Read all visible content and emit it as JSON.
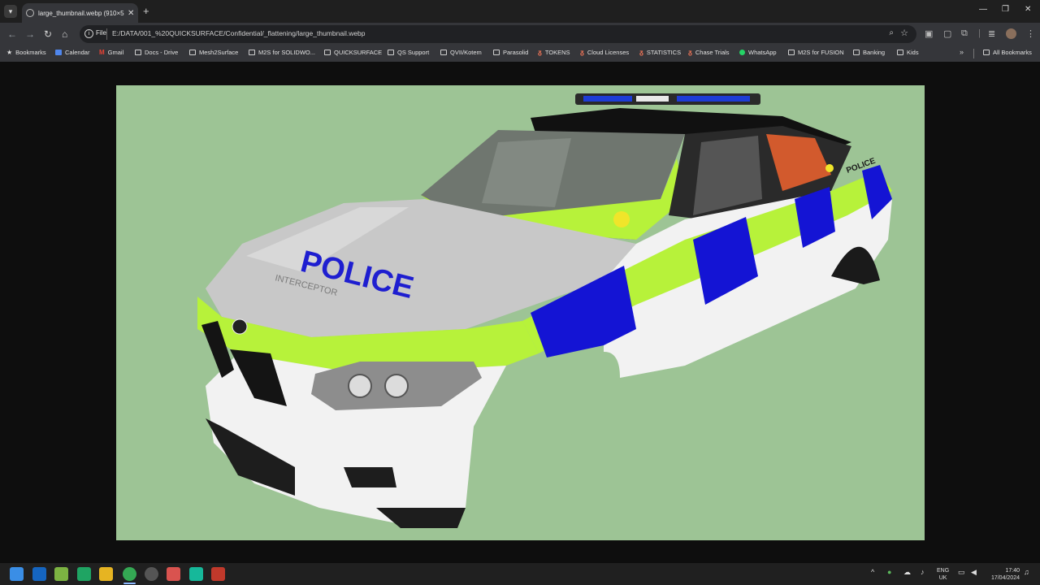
{
  "browser": {
    "tab": {
      "title": "large_thumbnail.webp (910×512)",
      "close": "✕"
    },
    "new_tab": "+",
    "window_controls": {
      "minimize": "—",
      "restore": "❐",
      "close": "✕"
    },
    "nav": {
      "back": "←",
      "forward": "→",
      "reload": "↻",
      "home": "⌂"
    },
    "omnibox": {
      "info_icon": "i",
      "scheme": "File",
      "url": "E:/DATA/001_%20QUICKSURFACE/Confidential/_flattening/large_thumbnail.webp",
      "zoom": "⌕",
      "star": "☆"
    }
  },
  "bookmarks": {
    "items": [
      {
        "label": "Bookmarks",
        "icon": "star-icon"
      },
      {
        "label": "Calendar",
        "icon": "calendar-icon"
      },
      {
        "label": "Gmail",
        "icon": "gmail-icon"
      },
      {
        "label": "Docs - Drive",
        "icon": "folder-icon"
      },
      {
        "label": "Mesh2Surface",
        "icon": "folder-icon"
      },
      {
        "label": "M2S for SOLIDWO...",
        "icon": "folder-icon"
      },
      {
        "label": "QUICKSURFACE",
        "icon": "folder-icon"
      },
      {
        "label": "QS Support",
        "icon": "folder-icon"
      },
      {
        "label": "QVII/Kotem",
        "icon": "folder-icon"
      },
      {
        "label": "Parasolid",
        "icon": "folder-icon"
      },
      {
        "label": "TOKENS",
        "icon": "ug-icon"
      },
      {
        "label": "Cloud Licenses",
        "icon": "ug-icon"
      },
      {
        "label": "STATISTICS",
        "icon": "ug-icon"
      },
      {
        "label": "Chase Trials",
        "icon": "ug-icon"
      },
      {
        "label": "WhatsApp",
        "icon": "whatsapp-icon"
      },
      {
        "label": "M2S for FUSION",
        "icon": "folder-icon"
      },
      {
        "label": "Banking",
        "icon": "folder-icon"
      },
      {
        "label": "Kids",
        "icon": "folder-icon"
      }
    ],
    "more": "»",
    "all_bookmarks": "All Bookmarks"
  },
  "image": {
    "hood_text": "POLICE",
    "hood_subtext": "INTERCEPTOR",
    "side_text": "POLICE",
    "colors": {
      "background": "#9dc495",
      "livery_yellow": "#b7f23a",
      "livery_blue": "#1414d4",
      "body_white": "#f2f2f2",
      "hood_grey": "#c8c8c8"
    }
  },
  "taskbar": {
    "lang": "ENG",
    "region": "UK",
    "time": "17:40",
    "date": "17/04/2024"
  }
}
